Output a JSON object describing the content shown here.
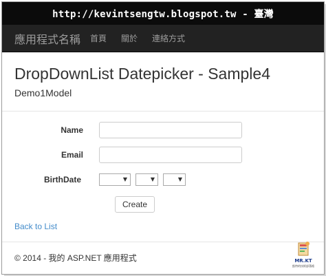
{
  "url_banner": "http://kevintsengtw.blogspot.tw - 臺灣",
  "navbar": {
    "brand": "應用程式名稱",
    "links": [
      "首頁",
      "關於",
      "連絡方式"
    ]
  },
  "page": {
    "title": "DropDownList Datepicker - Sample4",
    "model": "Demo1Model"
  },
  "form": {
    "name_label": "Name",
    "name_value": "",
    "email_label": "Email",
    "email_value": "",
    "birthdate_label": "BirthDate",
    "birthdate_selects": [
      "",
      "",
      ""
    ],
    "create_label": "Create"
  },
  "back_link": "Back to List",
  "footer": "© 2014 - 我的 ASP.NET 應用程式",
  "logo": {
    "text": "MR.KT",
    "subtext": "凱特的技術部落格"
  },
  "colors": {
    "navbar_bg": "#222222",
    "link": "#428bca",
    "banner_bg": "#0b0b0b"
  }
}
